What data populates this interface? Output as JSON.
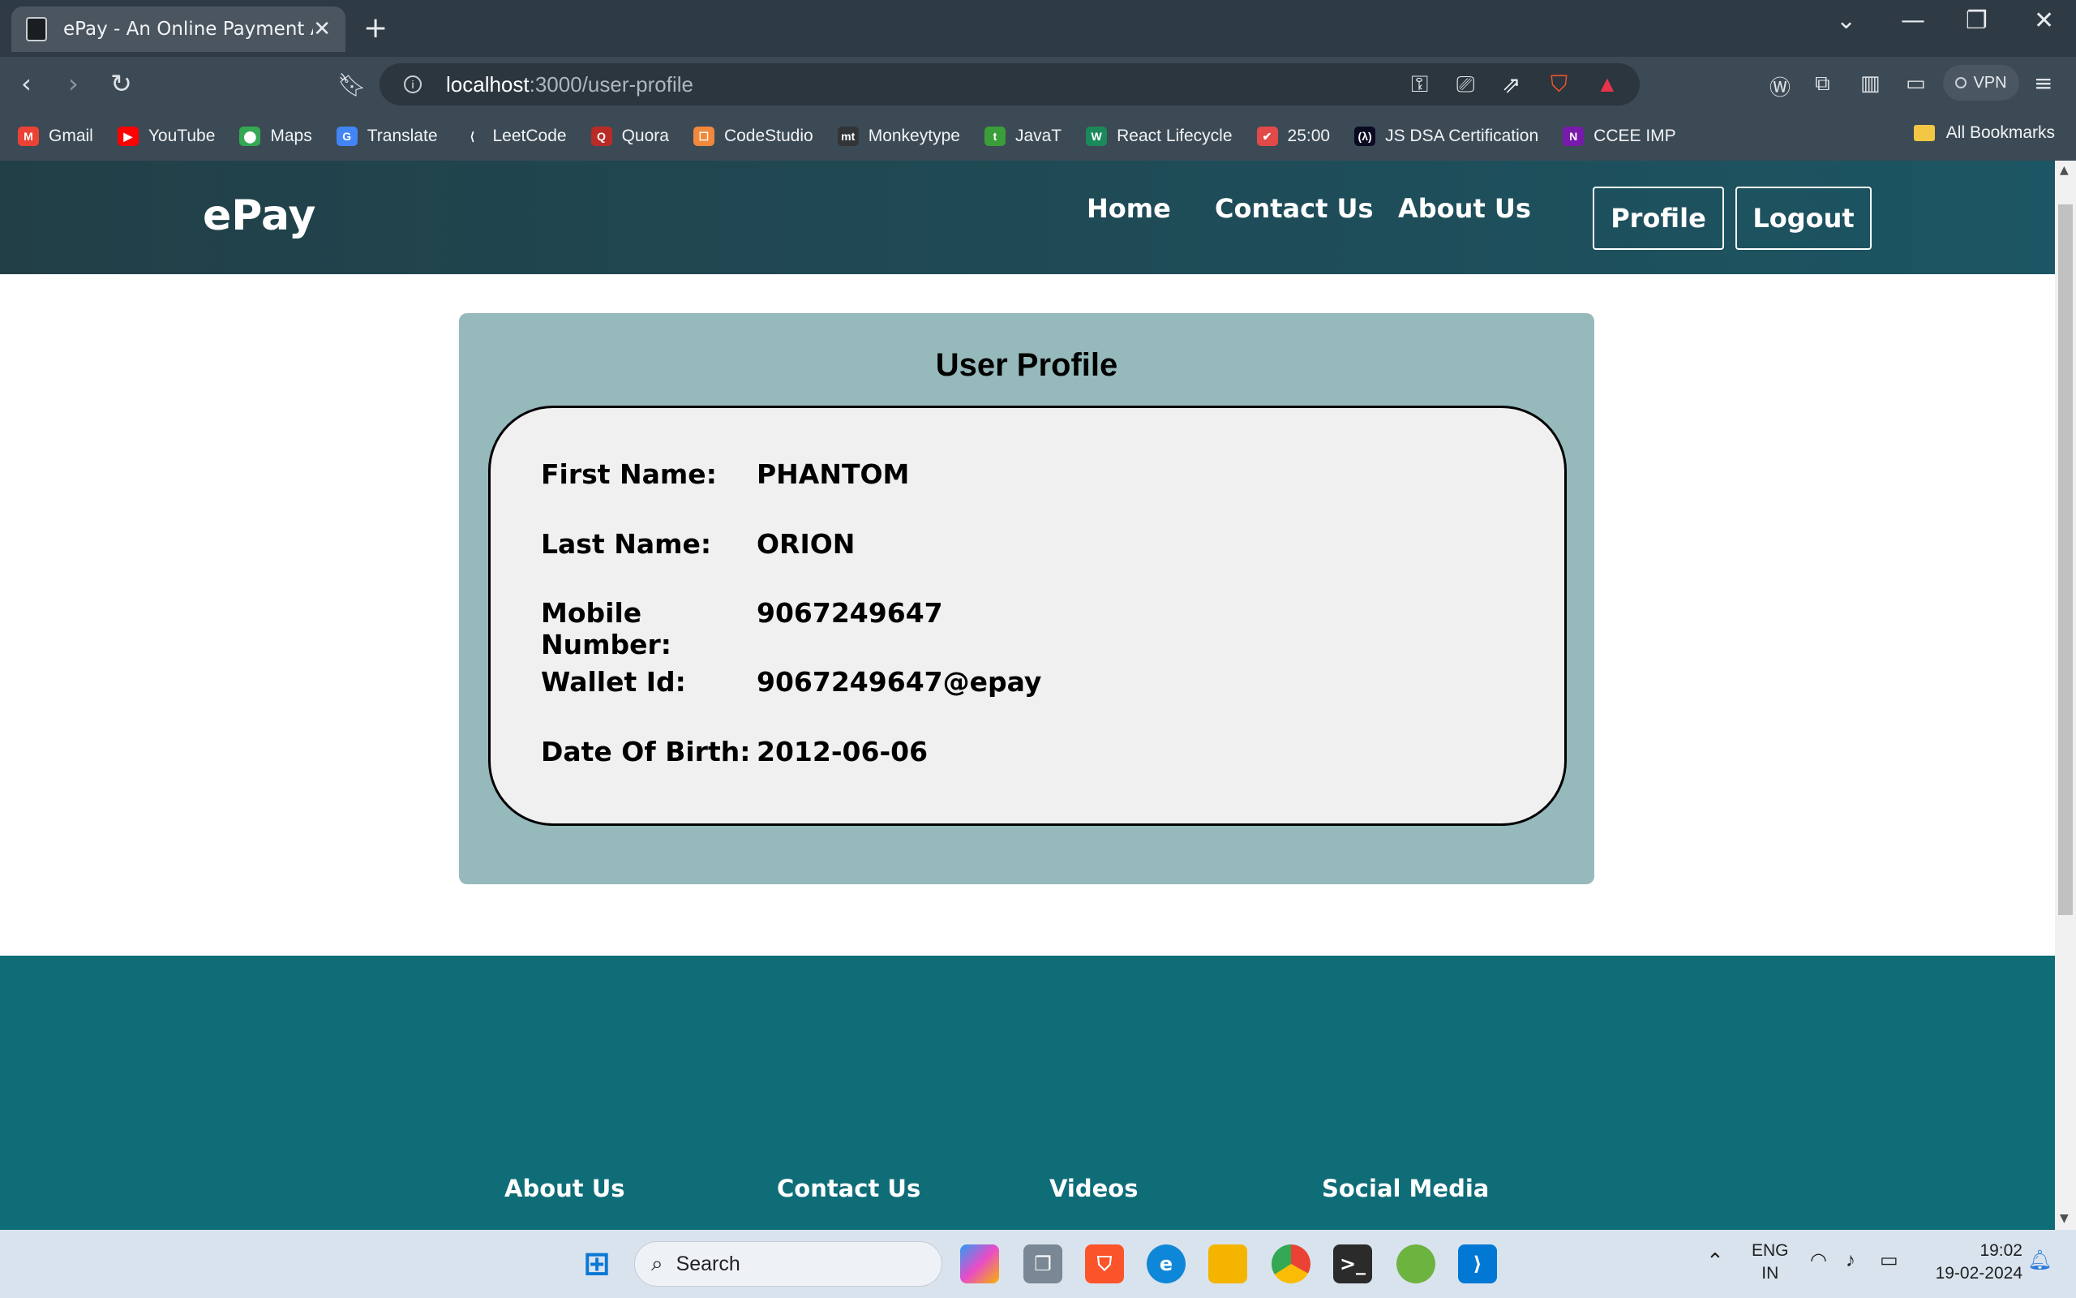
{
  "browser": {
    "tab_title": "ePay - An Online Payment App",
    "tab_close": "✕",
    "new_tab": "+",
    "url_host": "localhost",
    "url_path": ":3000/user-profile",
    "vpn_label": "VPN",
    "all_bookmarks": "All Bookmarks",
    "bookmarks": [
      {
        "label": "Gmail",
        "icon": "gmail-icon",
        "color": "#ea4335",
        "glyph": "M"
      },
      {
        "label": "YouTube",
        "icon": "youtube-icon",
        "color": "#ff0000",
        "glyph": "▶"
      },
      {
        "label": "Maps",
        "icon": "maps-icon",
        "color": "#34a853",
        "glyph": "⬤"
      },
      {
        "label": "Translate",
        "icon": "translate-icon",
        "color": "#4285f4",
        "glyph": "G"
      },
      {
        "label": "LeetCode",
        "icon": "leetcode-icon",
        "color": "#3c4a55",
        "glyph": "⟨"
      },
      {
        "label": "Quora",
        "icon": "quora-icon",
        "color": "#b92b27",
        "glyph": "Q"
      },
      {
        "label": "CodeStudio",
        "icon": "codestudio-icon",
        "color": "#f0893c",
        "glyph": "☐"
      },
      {
        "label": "Monkeytype",
        "icon": "monkeytype-icon",
        "color": "#323437",
        "glyph": "mt"
      },
      {
        "label": "JavaT",
        "icon": "javat-icon",
        "color": "#3a9e3a",
        "glyph": "t"
      },
      {
        "label": "React Lifecycle",
        "icon": "react-lifecycle-icon",
        "color": "#1a8a5a",
        "glyph": "W"
      },
      {
        "label": "25:00",
        "icon": "timer-icon",
        "color": "#e24a4a",
        "glyph": "✔"
      },
      {
        "label": "JS DSA Certification",
        "icon": "freecodecamp-icon",
        "color": "#0a0a23",
        "glyph": "(λ)"
      },
      {
        "label": "CCEE IMP",
        "icon": "onenote-icon",
        "color": "#7719aa",
        "glyph": "N"
      }
    ]
  },
  "site": {
    "brand": "ePay",
    "nav": {
      "home": "Home",
      "contact": "Contact Us",
      "about": "About Us"
    },
    "buttons": {
      "profile": "Profile",
      "logout": "Logout"
    }
  },
  "profile": {
    "title": "User Profile",
    "fields": [
      {
        "label": "First Name:",
        "value": "PHANTOM"
      },
      {
        "label": "Last Name:",
        "value": "ORION"
      },
      {
        "label": "Mobile Number:",
        "value": "9067249647"
      },
      {
        "label": "Wallet Id:",
        "value": "9067249647@epay"
      },
      {
        "label": "Date Of Birth:",
        "value": "2012-06-06"
      }
    ]
  },
  "footer": {
    "links": [
      "About Us",
      "Contact Us",
      "Videos",
      "Social Media"
    ]
  },
  "taskbar": {
    "search_label": "Search",
    "lang_top": "ENG",
    "lang_bottom": "IN",
    "time": "19:02",
    "date": "19-02-2024"
  },
  "colors": {
    "header_start": "#223f47",
    "header_end": "#1c5563",
    "card_bg": "#96b9bb",
    "inner_bg": "#f0f0f0",
    "footer_bg": "#0f6d78"
  }
}
